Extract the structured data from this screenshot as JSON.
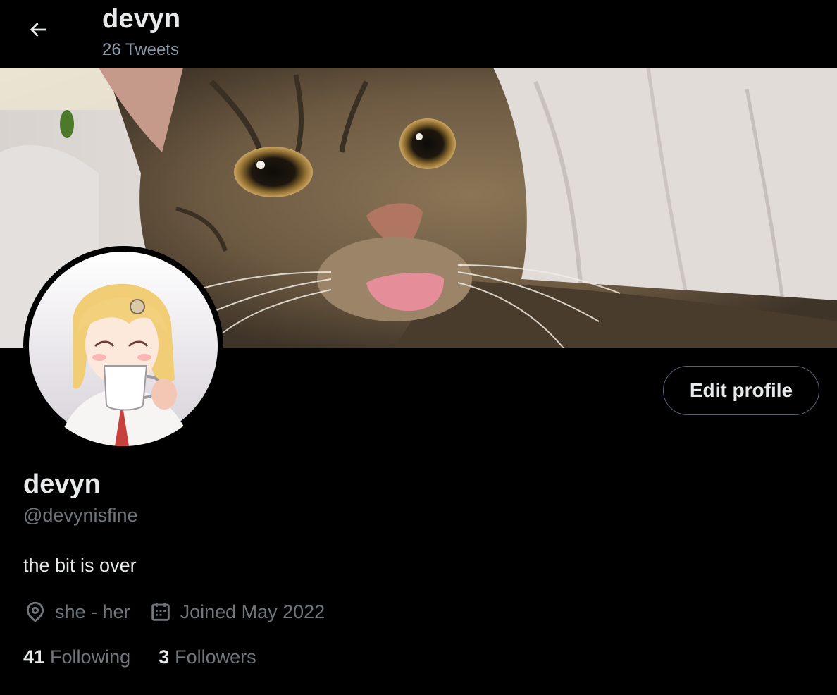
{
  "header": {
    "back_icon": "arrow-left-icon",
    "title": "devyn",
    "subtitle": "26 Tweets"
  },
  "banner": {
    "icon": "banner-image"
  },
  "avatar": {
    "icon": "profile-avatar-image"
  },
  "actions": {
    "edit_profile_label": "Edit profile"
  },
  "profile": {
    "name": "devyn",
    "handle": "@devynisfine",
    "bio": "the bit is over",
    "location_icon": "location-pin-icon",
    "location": "she - her",
    "joined_icon": "calendar-icon",
    "joined": "Joined May 2022"
  },
  "stats": {
    "following_count": "41",
    "following_label": "Following",
    "followers_count": "3",
    "followers_label": "Followers"
  },
  "colors": {
    "background": "#000000",
    "text_primary": "#e7e9ea",
    "text_secondary": "#71767b",
    "button_border": "#536471"
  }
}
